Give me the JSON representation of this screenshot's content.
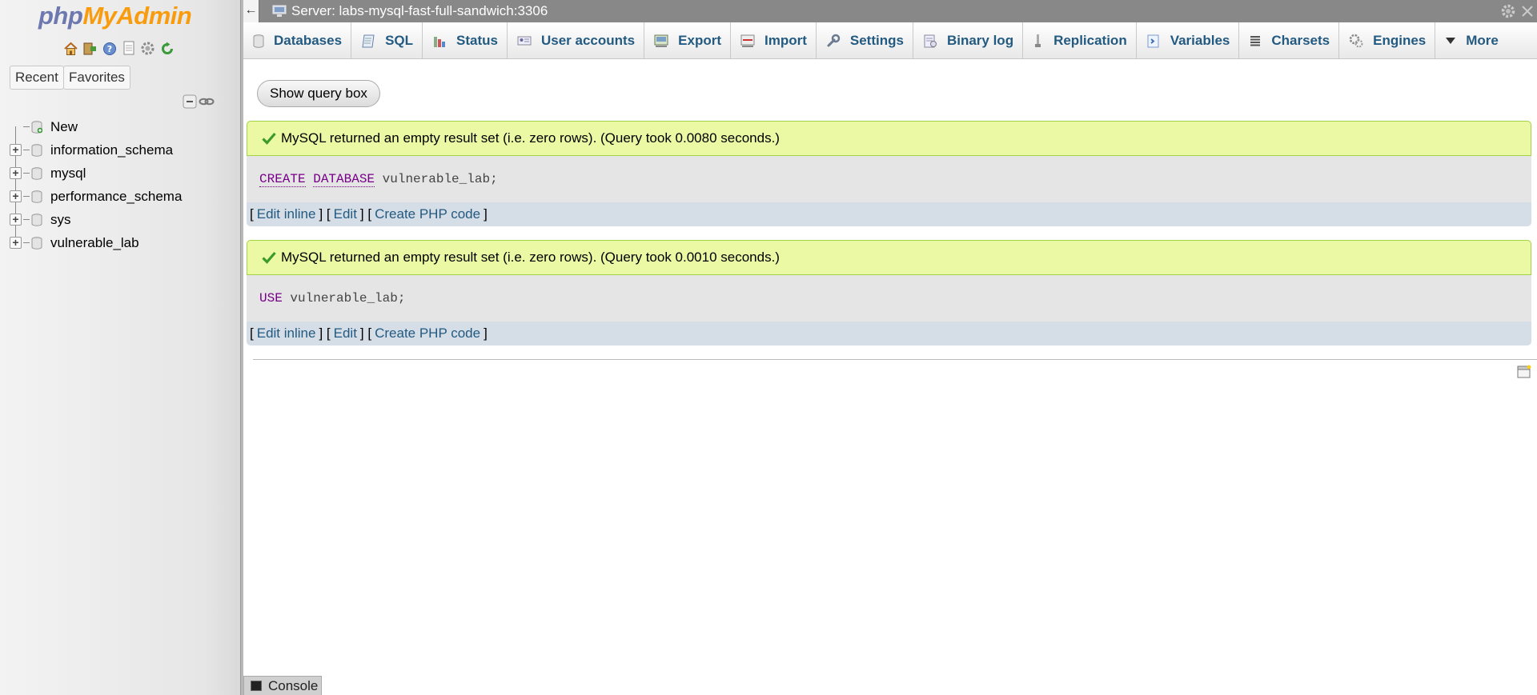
{
  "sidebar": {
    "logo_php": "php",
    "logo_myadmin": "MyAdmin",
    "quick_icons": [
      "home-icon",
      "exit-icon",
      "help-icon",
      "docs-icon",
      "settings-icon",
      "reload-icon"
    ],
    "recent_label": "Recent",
    "favorites_label": "Favorites",
    "tree": [
      {
        "label": "New",
        "type": "new"
      },
      {
        "label": "information_schema",
        "type": "db"
      },
      {
        "label": "mysql",
        "type": "db"
      },
      {
        "label": "performance_schema",
        "type": "db"
      },
      {
        "label": "sys",
        "type": "db"
      },
      {
        "label": "vulnerable_lab",
        "type": "db"
      }
    ]
  },
  "server_bar": {
    "collapse": "←",
    "title": "Server: labs-mysql-fast-full-sandwich:3306"
  },
  "nav_tabs": [
    {
      "label": "Databases",
      "icon": "databases-icon"
    },
    {
      "label": "SQL",
      "icon": "sql-icon"
    },
    {
      "label": "Status",
      "icon": "status-icon"
    },
    {
      "label": "User accounts",
      "icon": "user-accounts-icon"
    },
    {
      "label": "Export",
      "icon": "export-icon"
    },
    {
      "label": "Import",
      "icon": "import-icon"
    },
    {
      "label": "Settings",
      "icon": "settings-icon"
    },
    {
      "label": "Binary log",
      "icon": "binary-log-icon"
    },
    {
      "label": "Replication",
      "icon": "replication-icon"
    },
    {
      "label": "Variables",
      "icon": "variables-icon"
    },
    {
      "label": "Charsets",
      "icon": "charsets-icon"
    },
    {
      "label": "Engines",
      "icon": "engines-icon"
    },
    {
      "label": "More",
      "icon": "more-icon"
    }
  ],
  "main": {
    "show_query_label": "Show query box",
    "results": [
      {
        "message": "MySQL returned an empty result set (i.e. zero rows). (Query took 0.0080 seconds.)",
        "sql_kw1": "CREATE",
        "sql_kw2": "DATABASE",
        "sql_rest": "vulnerable_lab;",
        "link_edit_inline": "Edit inline",
        "link_edit": "Edit",
        "link_php": "Create PHP code"
      },
      {
        "message": "MySQL returned an empty result set (i.e. zero rows). (Query took 0.0010 seconds.)",
        "sql_kw1": "USE",
        "sql_rest": "vulnerable_lab;",
        "link_edit_inline": "Edit inline",
        "link_edit": "Edit",
        "link_php": "Create PHP code"
      }
    ]
  },
  "console": {
    "label": "Console"
  },
  "colors": {
    "link": "#235a81",
    "success_bg": "#ebf8a4",
    "keyword": "#770088"
  }
}
